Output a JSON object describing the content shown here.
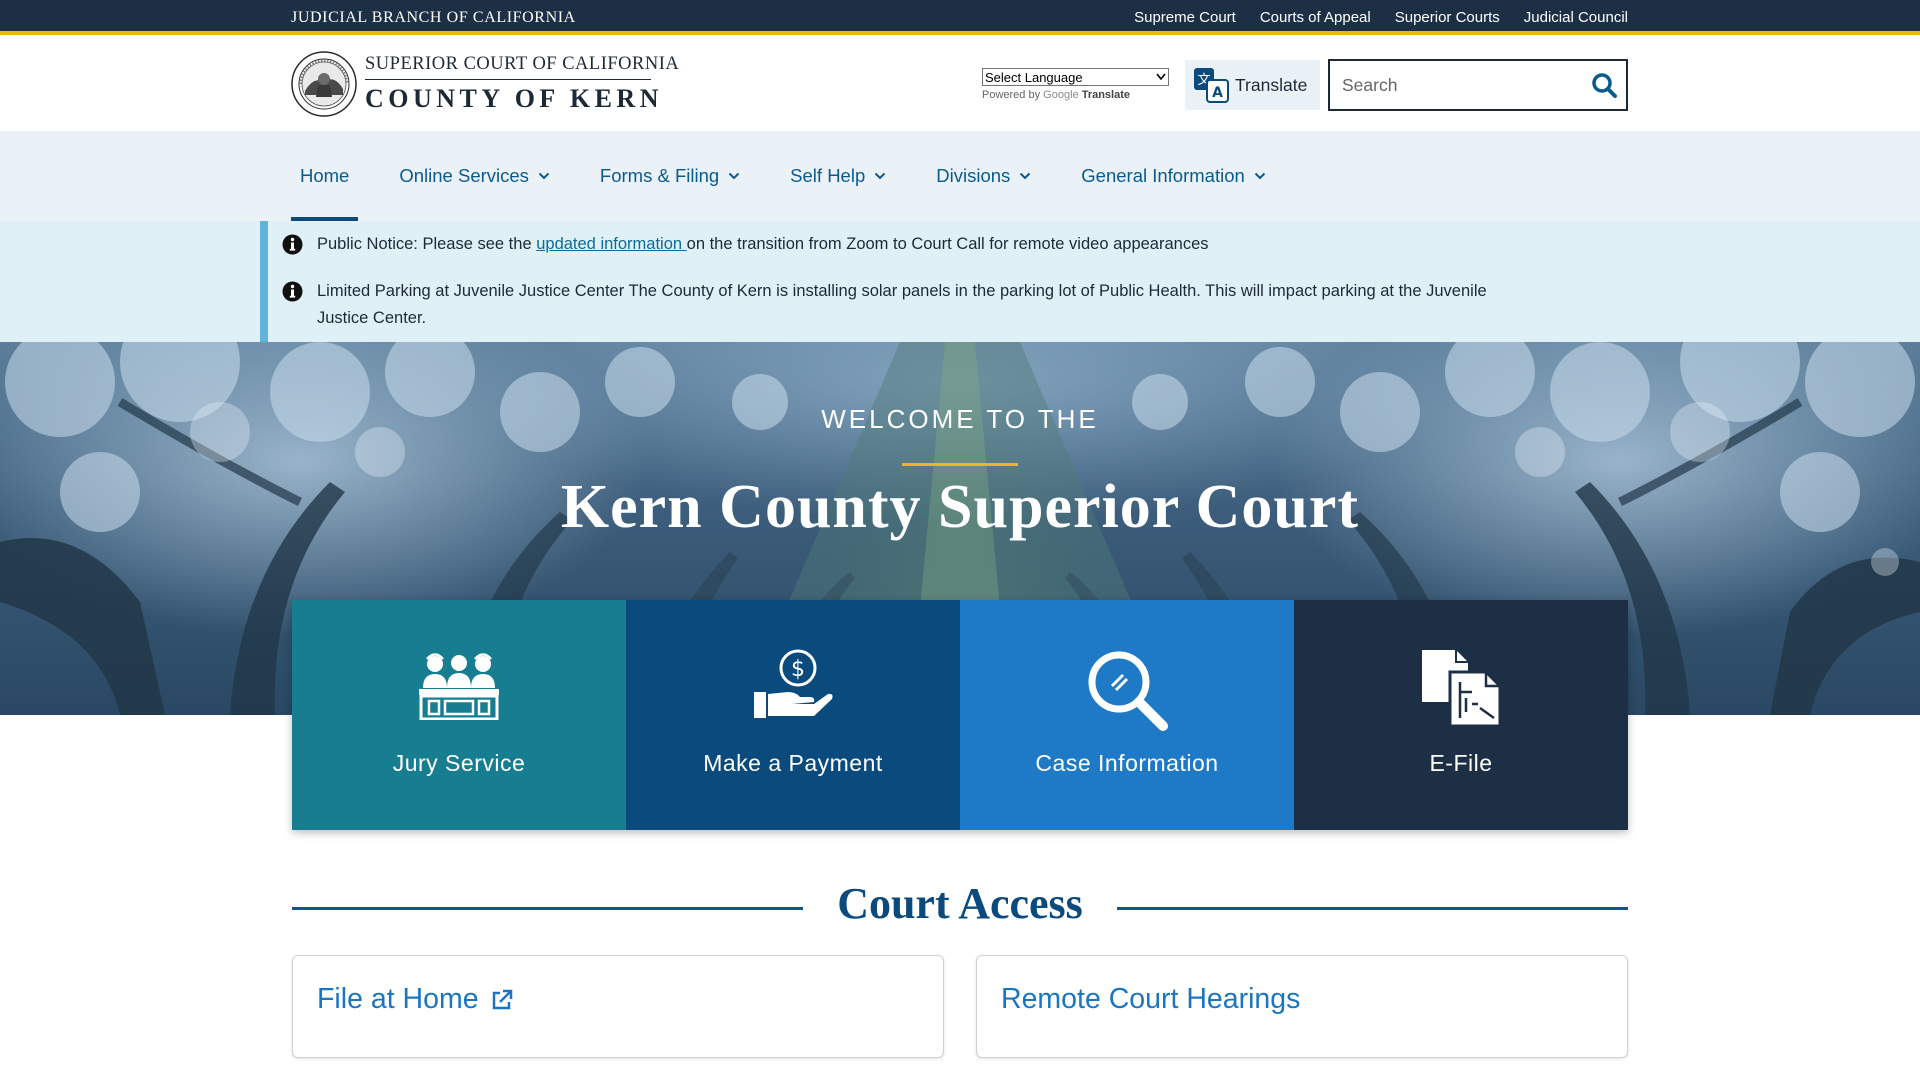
{
  "utility_bar": {
    "branch_title": "JUDICIAL BRANCH OF CALIFORNIA",
    "links": [
      "Supreme Court",
      "Courts of Appeal",
      "Superior Courts",
      "Judicial Council"
    ]
  },
  "header": {
    "logo_line1": "SUPERIOR COURT OF CALIFORNIA",
    "logo_line2": "COUNTY OF KERN",
    "language_select": "Select Language",
    "powered_by": "Powered by",
    "google_word": "Google",
    "google_translate": "Translate",
    "translate_label": "Translate",
    "search_placeholder": "Search"
  },
  "nav": {
    "items": [
      {
        "label": "Home",
        "active": true,
        "dropdown": false
      },
      {
        "label": "Online Services",
        "active": false,
        "dropdown": true
      },
      {
        "label": "Forms & Filing",
        "active": false,
        "dropdown": true
      },
      {
        "label": "Self Help",
        "active": false,
        "dropdown": true
      },
      {
        "label": "Divisions",
        "active": false,
        "dropdown": true
      },
      {
        "label": "General Information",
        "active": false,
        "dropdown": true
      }
    ]
  },
  "alerts": [
    {
      "before": "Public Notice: Please see the ",
      "link": "updated information ",
      "after": "on the transition from Zoom to Court Call for remote video appearances"
    },
    {
      "text": "Limited Parking at Juvenile Justice Center The County of Kern is installing solar panels in the parking lot of Public Health. This will impact parking at the Juvenile Justice Center."
    }
  ],
  "hero": {
    "welcome": "WELCOME TO THE",
    "title": "Kern County Superior Court"
  },
  "tiles": [
    {
      "label": "Jury Service",
      "icon": "jury-icon",
      "color": "#177d90"
    },
    {
      "label": "Make a Payment",
      "icon": "payment-icon",
      "color": "#0b4a7c"
    },
    {
      "label": "Case Information",
      "icon": "magnifier-icon",
      "color": "#1e7ac6"
    },
    {
      "label": "E-File",
      "icon": "efile-icon",
      "color": "#1d2f45"
    }
  ],
  "court_access": {
    "title": "Court Access",
    "cards": [
      {
        "title": "File at Home",
        "external": true
      },
      {
        "title": "Remote Court Hearings",
        "external": false
      }
    ]
  },
  "colors": {
    "utility_bg": "#1d2f45",
    "gold_accent": "#f1b51c",
    "nav_bg": "#eaf2f8",
    "nav_text": "#0b5a8e",
    "alert_bg": "#dff0f7",
    "alert_bar": "#5fb4d8",
    "card_title": "#1a76c2"
  }
}
